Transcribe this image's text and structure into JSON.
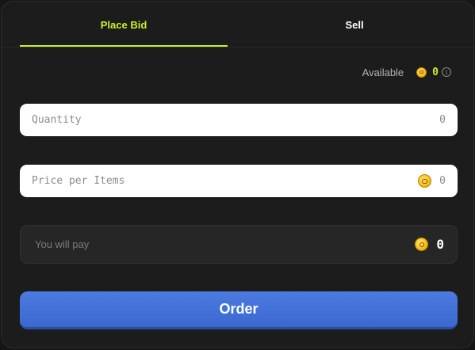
{
  "tabs": [
    {
      "label": "Place Bid",
      "active": true
    },
    {
      "label": "Sell",
      "active": false
    }
  ],
  "available": {
    "label": "Available",
    "value": "0",
    "icon": "coin-icon"
  },
  "quantity": {
    "placeholder": "Quantity",
    "value": "0"
  },
  "price": {
    "placeholder": "Price per Items",
    "value": "0",
    "icon": "coin-icon"
  },
  "pay": {
    "label": "You will pay",
    "value": "0",
    "icon": "coin-icon"
  },
  "order": {
    "label": "Order"
  },
  "colors": {
    "accent": "#c8f02a",
    "button": "#3f6fd8",
    "panel": "#1c1c1c"
  }
}
